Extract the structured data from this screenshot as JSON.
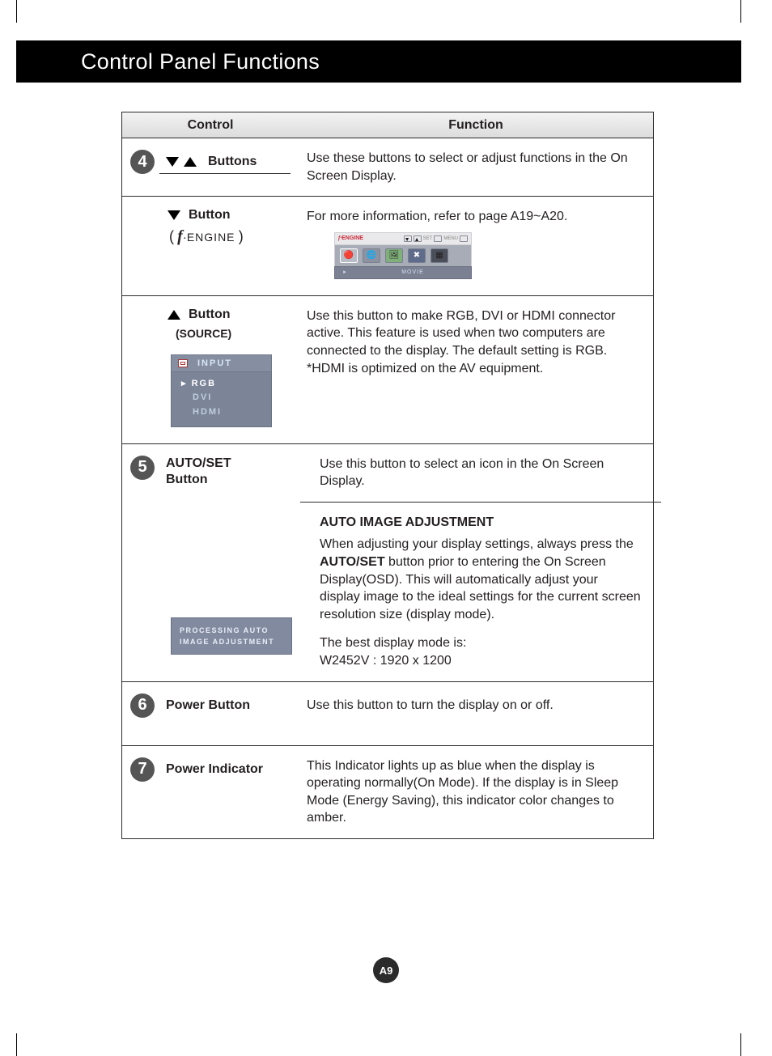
{
  "header": {
    "title": "Control Panel Functions"
  },
  "table": {
    "head": {
      "control": "Control",
      "function": "Function"
    },
    "rows": [
      {
        "num": "4",
        "control_label": "Buttons",
        "function_text": "Use these buttons to select or adjust functions in the On Screen Display."
      },
      {
        "control_label": "Button",
        "sub_label_prefix": "(",
        "sub_label_engine_f": "f",
        "sub_label_engine_rest": "ENGINE",
        "sub_label_suffix": ")",
        "function_text": "For more information, refer to page A19~A20.",
        "osd_fengine": {
          "top_label_f": "f",
          "top_label_rest": "ENGINE",
          "top_right_set": "SET",
          "top_right_menu": "MENU",
          "bottom_label": "MOVIE"
        }
      },
      {
        "control_label": "Button",
        "control_sub": "(SOURCE)",
        "function_text": "Use this button to make RGB, DVI or HDMI connector active. This feature is used when two computers are connected to the display. The default setting is RGB. *HDMI is optimized on the AV equipment.",
        "osd_input": {
          "header": "INPUT",
          "items": [
            "RGB",
            "DVI",
            "HDMI"
          ],
          "selected_index": 0
        }
      },
      {
        "num": "5",
        "control_label": "AUTO/SET Button",
        "function_text": "Use this button to select an icon in the On Screen Display.",
        "sub": {
          "heading": "AUTO IMAGE ADJUSTMENT",
          "body_pre": "When adjusting your display settings, always press the ",
          "body_bold": "AUTO/SET",
          "body_post": " button prior to entering the On Screen Display(OSD). This will automatically adjust your display image to the ideal settings for the current screen resolution size (display mode).",
          "best_mode_label": "The best display mode is:",
          "best_mode_value": "W2452V : 1920 x 1200",
          "proc_box_line1": "PROCESSING AUTO",
          "proc_box_line2": "IMAGE ADJUSTMENT"
        }
      },
      {
        "num": "6",
        "control_label": "Power Button",
        "function_text": "Use this button to turn the display on or off."
      },
      {
        "num": "7",
        "control_label": "Power Indicator",
        "function_text": "This Indicator lights up as blue when the display is operating normally(On Mode). If the display is in Sleep Mode (Energy Saving), this indicator color changes to amber."
      }
    ]
  },
  "footer": {
    "page_label": "A9"
  }
}
